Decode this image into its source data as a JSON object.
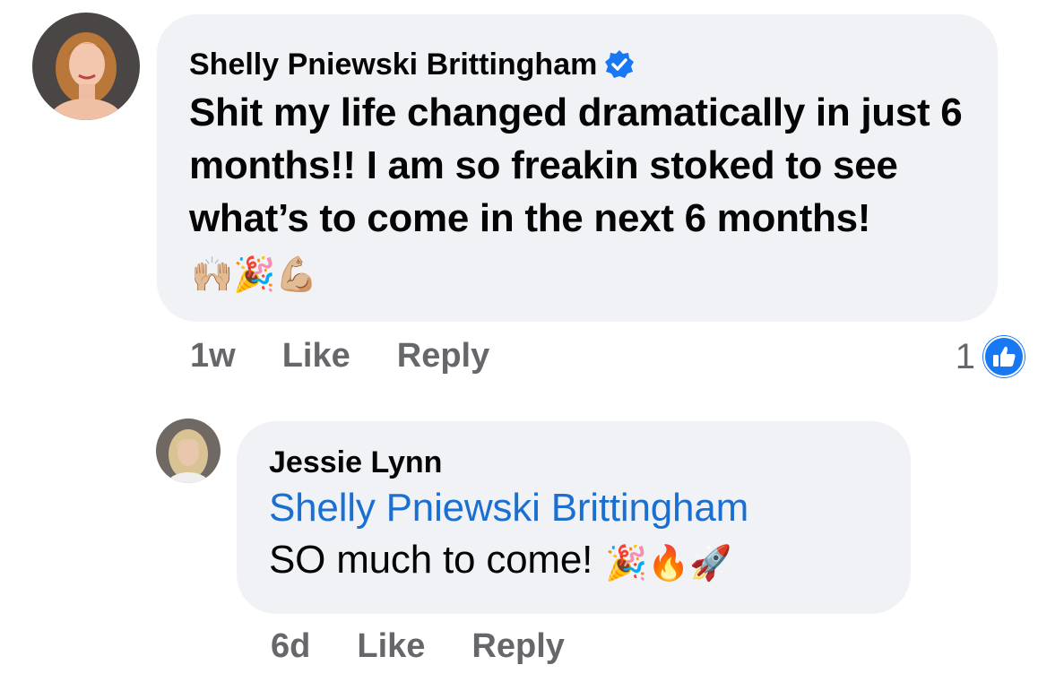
{
  "comments": [
    {
      "author": "Shelly Pniewski Brittingham",
      "verified": true,
      "text": "Shit my life changed dramatically in just 6 months!! I am so freakin stoked to see what’s to come in the next 6 months!",
      "emojis": "🙌🏼🎉💪🏼",
      "time": "1w",
      "like_label": "Like",
      "reply_label": "Reply",
      "reaction_count": "1",
      "reaction_icon": "like-thumbs-up-icon",
      "avatar_icon": "user-avatar-icon"
    },
    {
      "author": "Jessie Lynn",
      "mention": "Shelly Pniewski Brittingham",
      "text": "SO much to come!",
      "emojis": "🎉🔥🚀",
      "time": "6d",
      "like_label": "Like",
      "reply_label": "Reply",
      "avatar_icon": "user-avatar-icon"
    }
  ],
  "colors": {
    "bubble": "#f0f2f5",
    "mention": "#1b6fd1",
    "meta": "#65676b",
    "like_blue": "#1877f2"
  }
}
